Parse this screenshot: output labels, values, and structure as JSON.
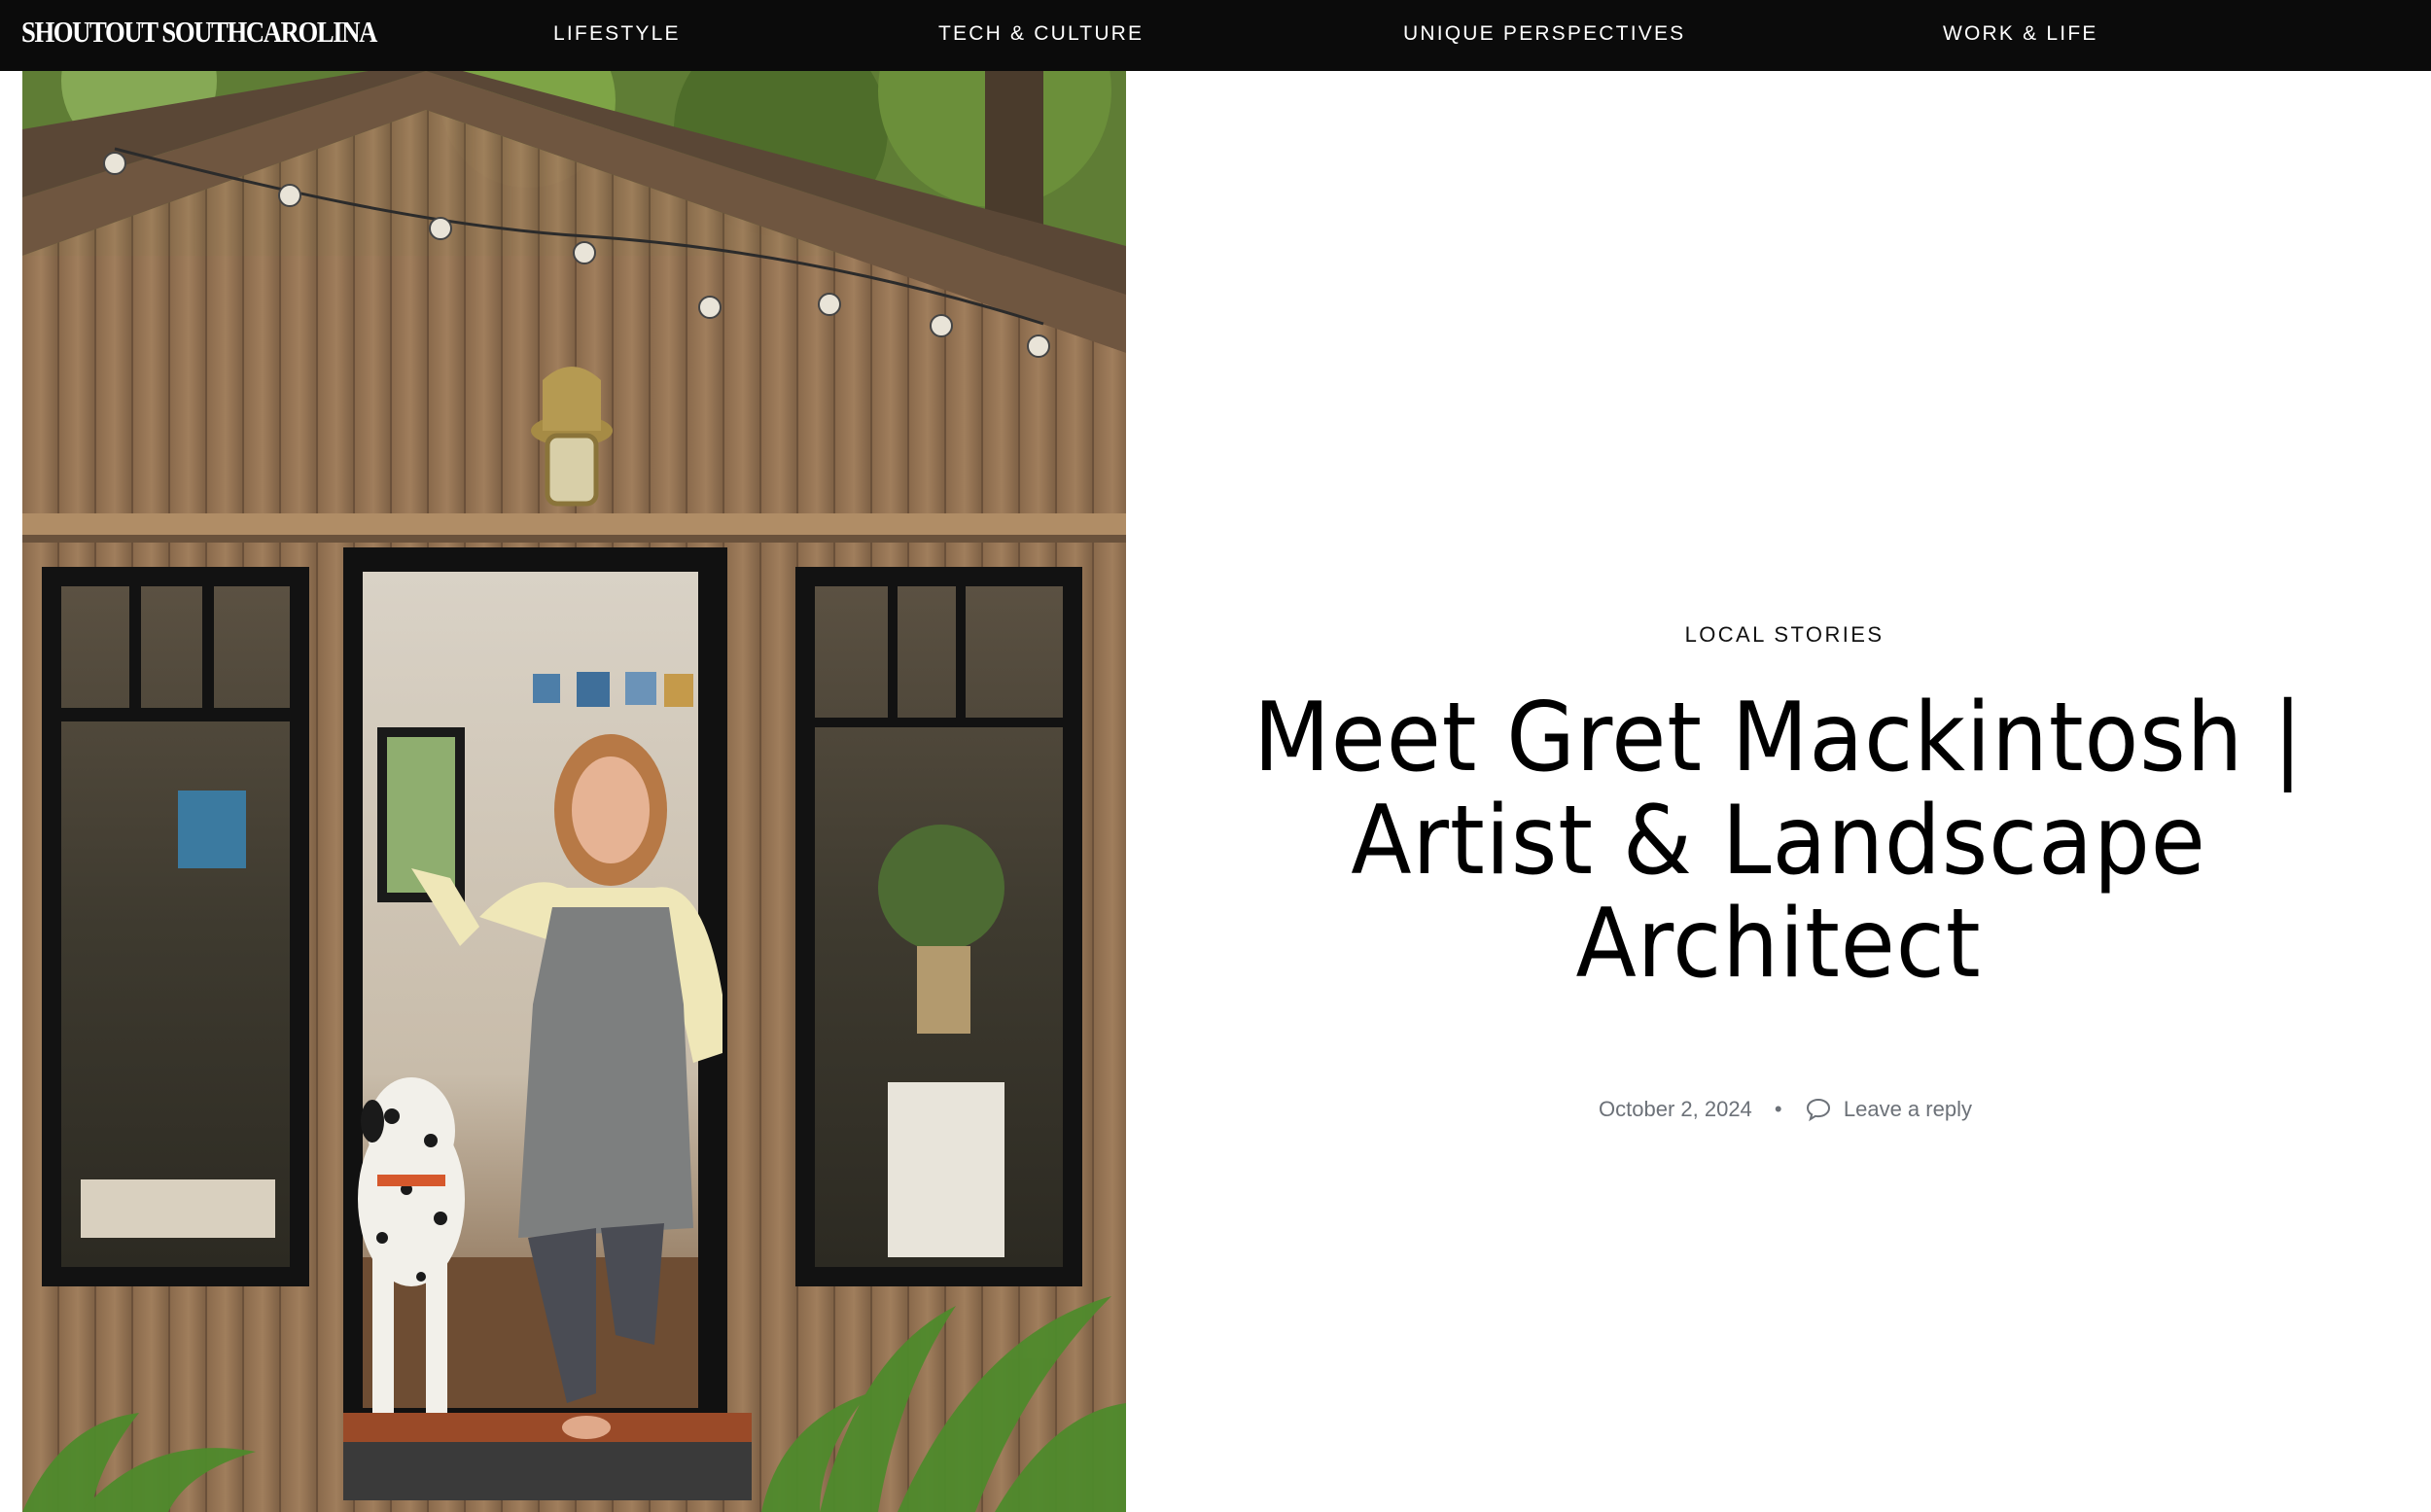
{
  "site": {
    "brand": "SHOUTOUT SOUTHCAROLINA"
  },
  "nav": {
    "items": [
      {
        "label": "LIFESTYLE"
      },
      {
        "label": "TECH & CULTURE"
      },
      {
        "label": "UNIQUE PERSPECTIVES"
      },
      {
        "label": "WORK & LIFE"
      }
    ]
  },
  "hero": {
    "image_icon": "photo-artist-studio"
  },
  "article": {
    "category": "LOCAL STORIES",
    "title": "Meet Gret Mackintosh | Artist & Landscape Architect",
    "date": "October 2, 2024",
    "separator": "•",
    "reply_label": "Leave a reply",
    "reply_icon": "comment-bubble-icon"
  },
  "colors": {
    "nav_background": "#0b0b0b",
    "nav_text": "#ffffff",
    "title_text": "#000000",
    "meta_text": "#6c7178"
  }
}
